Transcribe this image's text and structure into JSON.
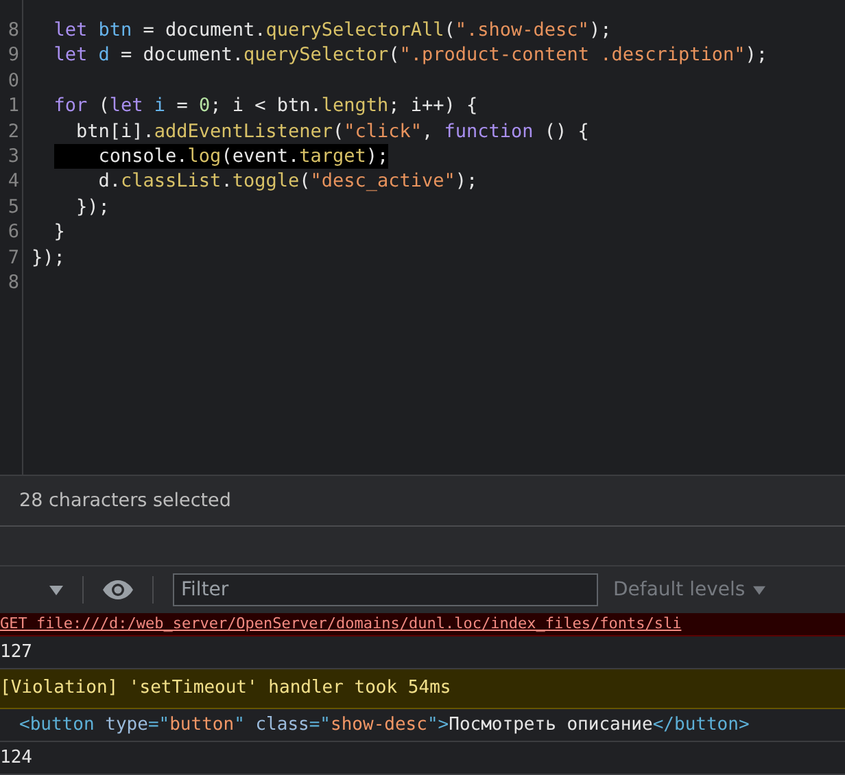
{
  "editor": {
    "lines": [
      {
        "number": "8",
        "selected": false,
        "tokens": [
          {
            "t": "  let ",
            "kind": "keyword"
          },
          {
            "t": "btn",
            "kind": "variable"
          },
          {
            "t": " = document.",
            "kind": "plain"
          },
          {
            "t": "querySelectorAll",
            "kind": "method"
          },
          {
            "t": "(",
            "kind": "plain"
          },
          {
            "t": "\".show-desc\"",
            "kind": "string"
          },
          {
            "t": ");",
            "kind": "plain"
          }
        ]
      },
      {
        "number": "9",
        "selected": false,
        "tokens": [
          {
            "t": "  let ",
            "kind": "keyword"
          },
          {
            "t": "d",
            "kind": "variable"
          },
          {
            "t": " = document.",
            "kind": "plain"
          },
          {
            "t": "querySelector",
            "kind": "method"
          },
          {
            "t": "(",
            "kind": "plain"
          },
          {
            "t": "\".product-content .description\"",
            "kind": "string"
          },
          {
            "t": ");",
            "kind": "plain"
          }
        ]
      },
      {
        "number": "0",
        "selected": false
      },
      {
        "number": "1",
        "selected": false,
        "tokens": [
          {
            "t": "  for",
            "kind": "keyword"
          },
          {
            "t": " (",
            "kind": "plain"
          },
          {
            "t": "let ",
            "kind": "keyword"
          },
          {
            "t": "i",
            "kind": "variable"
          },
          {
            "t": " = ",
            "kind": "plain"
          },
          {
            "t": "0",
            "kind": "number"
          },
          {
            "t": "; i < btn.",
            "kind": "plain"
          },
          {
            "t": "length",
            "kind": "method"
          },
          {
            "t": "; i++) {",
            "kind": "plain"
          }
        ]
      },
      {
        "number": "2",
        "selected": false,
        "tokens": [
          {
            "t": "    btn[i].",
            "kind": "plain"
          },
          {
            "t": "addEventListener",
            "kind": "method"
          },
          {
            "t": "(",
            "kind": "plain"
          },
          {
            "t": "\"click\"",
            "kind": "string"
          },
          {
            "t": ", ",
            "kind": "plain"
          },
          {
            "t": "function",
            "kind": "keyword"
          },
          {
            "t": " () {",
            "kind": "plain"
          }
        ]
      },
      {
        "number": "3",
        "selected": true,
        "tokens": [
          {
            "t": "      console.",
            "kind": "plain"
          },
          {
            "t": "log",
            "kind": "method"
          },
          {
            "t": "(event.",
            "kind": "plain"
          },
          {
            "t": "target",
            "kind": "method"
          },
          {
            "t": ");",
            "kind": "plain"
          }
        ]
      },
      {
        "number": "4",
        "selected": false,
        "tokens": [
          {
            "t": "      d.",
            "kind": "plain"
          },
          {
            "t": "classList",
            "kind": "method"
          },
          {
            "t": ".",
            "kind": "plain"
          },
          {
            "t": "toggle",
            "kind": "method"
          },
          {
            "t": "(",
            "kind": "plain"
          },
          {
            "t": "\"desc_active\"",
            "kind": "string"
          },
          {
            "t": ");",
            "kind": "plain"
          }
        ]
      },
      {
        "number": "5",
        "selected": false,
        "tokens": [
          {
            "t": "    });",
            "kind": "plain"
          }
        ]
      },
      {
        "number": "6",
        "selected": false,
        "tokens": [
          {
            "t": "  }",
            "kind": "plain"
          }
        ]
      },
      {
        "number": "7",
        "selected": false,
        "tokens": [
          {
            "t": "});",
            "kind": "plain"
          }
        ]
      },
      {
        "number": "8",
        "selected": false
      }
    ]
  },
  "status_bar": "28 characters selected",
  "console_toolbar": {
    "filter_placeholder": "Filter",
    "levels": "Default levels"
  },
  "console": [
    {
      "kind": "error",
      "tokens": [
        {
          "t": "GET file:///d:/web_server/OpenServer/domains/dunl.loc/index_files/fonts/sli",
          "kind": "plain"
        }
      ]
    },
    {
      "kind": "log",
      "tokens": [
        {
          "t": "127",
          "kind": "plain"
        }
      ]
    },
    {
      "kind": "warning",
      "tokens": [
        {
          "t": "[Violation] 'setTimeout' handler took 54ms",
          "kind": "plain"
        }
      ]
    },
    {
      "kind": "element",
      "tokens": [
        {
          "t": "<button ",
          "kind": "tag"
        },
        {
          "t": "type",
          "kind": "attr"
        },
        {
          "t": "=\"",
          "kind": "tag"
        },
        {
          "t": "button",
          "kind": "value"
        },
        {
          "t": "\" ",
          "kind": "tag"
        },
        {
          "t": "class",
          "kind": "attr"
        },
        {
          "t": "=\"",
          "kind": "tag"
        },
        {
          "t": "show-desc",
          "kind": "value"
        },
        {
          "t": "\">",
          "kind": "tag"
        },
        {
          "t": "Посмотреть описание",
          "kind": "plain"
        },
        {
          "t": "</button>",
          "kind": "tag"
        }
      ]
    },
    {
      "kind": "log",
      "tokens": [
        {
          "t": "124",
          "kind": "plain"
        }
      ]
    }
  ]
}
